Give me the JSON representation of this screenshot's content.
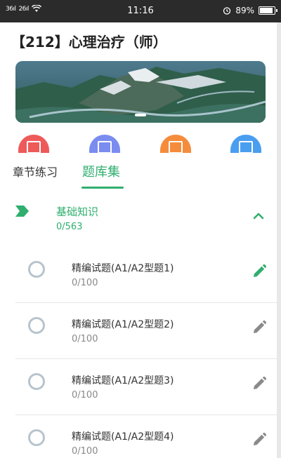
{
  "status_bar": {
    "signal_1": "36ıl",
    "signal_2": "26ıl",
    "time": "11:16",
    "battery": "89%",
    "battery_level": 0.89
  },
  "header": {
    "title": "【212】心理治疗（师）"
  },
  "shortcuts": [
    {
      "icon": "exam-icon",
      "color": "#ee5a5a"
    },
    {
      "icon": "calendar-icon",
      "color": "#7b8cf0"
    },
    {
      "icon": "exchange-icon",
      "color": "#f58c3c"
    },
    {
      "icon": "notebook-icon",
      "color": "#4a9ef0"
    }
  ],
  "tabs": [
    {
      "label": "章节练习",
      "active": false
    },
    {
      "label": "题库集",
      "active": true
    }
  ],
  "section": {
    "title": "基础知识",
    "progress": "0/563",
    "accent": "#2fae6e"
  },
  "items": [
    {
      "name": "精编试题(A1/A2型题1)",
      "progress": "0/100",
      "active": true
    },
    {
      "name": "精编试题(A1/A2型题2)",
      "progress": "0/100",
      "active": false
    },
    {
      "name": "精编试题(A1/A2型题3)",
      "progress": "0/100",
      "active": false
    },
    {
      "name": "精编试题(A1/A2型题4)",
      "progress": "0/100",
      "active": false
    }
  ]
}
